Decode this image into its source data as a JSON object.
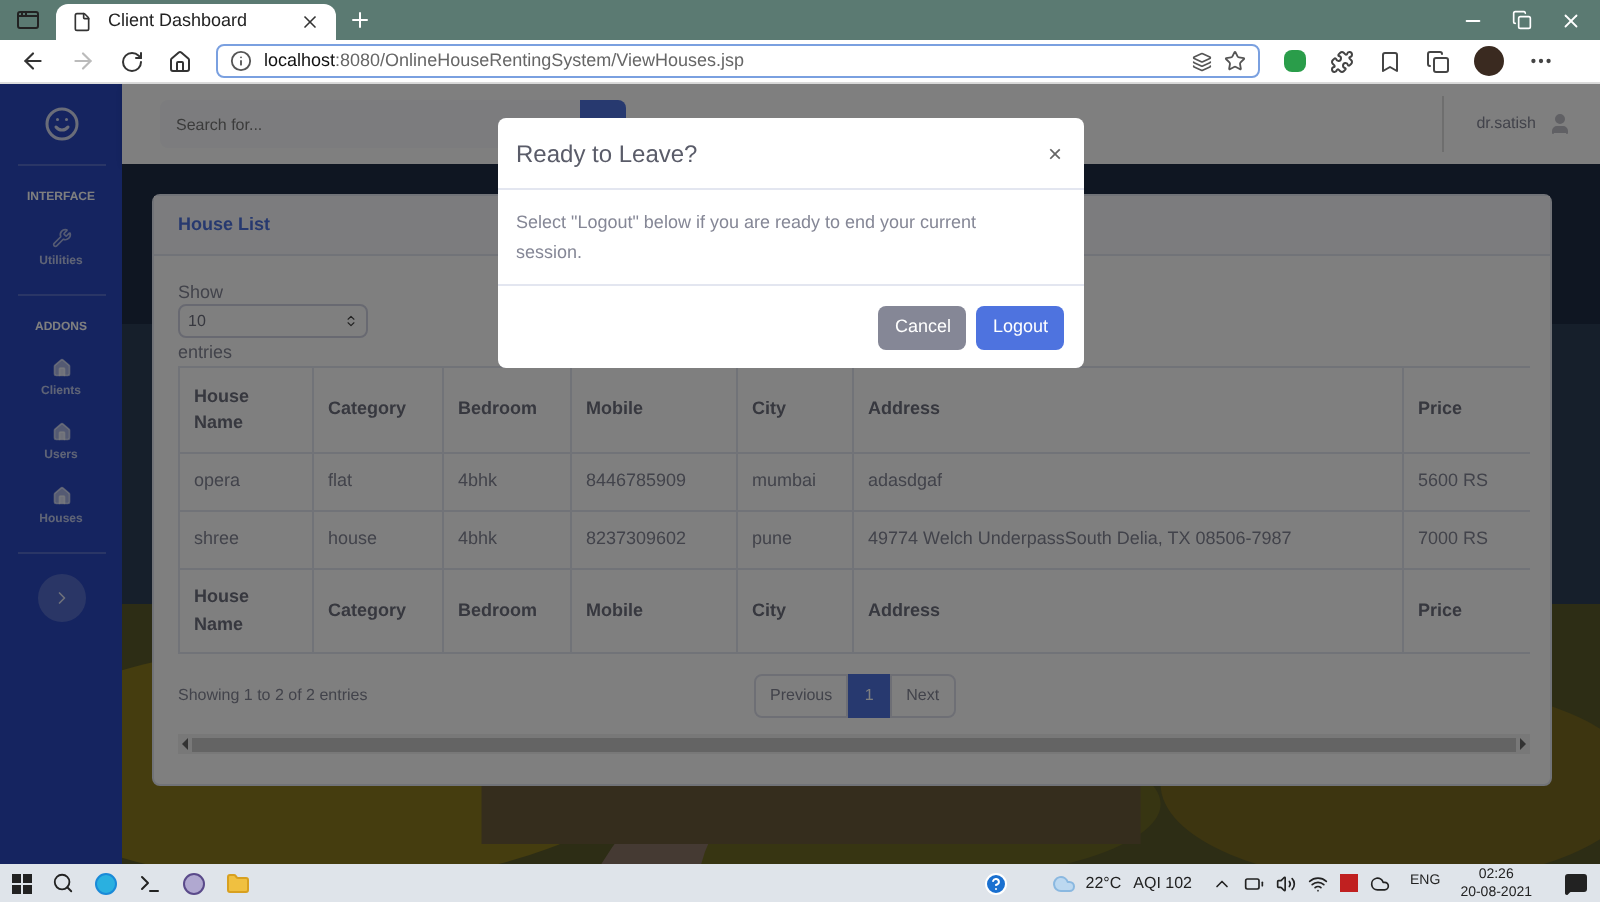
{
  "browser": {
    "tabs": [
      {
        "title": "Client Dashboard",
        "selected": true
      }
    ],
    "url_host": "localhost",
    "url_path": ":8080/OnlineHouseRentingSystem/ViewHouses.jsp"
  },
  "sidebar": {
    "sections": [
      {
        "heading": "INTERFACE",
        "items": [
          {
            "label": "Utilities",
            "kind": "wrench"
          }
        ]
      },
      {
        "heading": "ADDONS",
        "items": [
          {
            "label": "Clients",
            "kind": "home"
          },
          {
            "label": "Users",
            "kind": "home"
          },
          {
            "label": "Houses",
            "kind": "home"
          }
        ]
      }
    ]
  },
  "topbar": {
    "search": {
      "placeholder": "Search for..."
    },
    "user": "dr.satish"
  },
  "card": {
    "title": "House List",
    "show_label": "Show",
    "page_size": "10",
    "entries_label": "entries",
    "columns": [
      "House Name",
      "Category",
      "Bedroom",
      "Mobile",
      "City",
      "Address",
      "Price"
    ],
    "rows": [
      [
        "opera",
        "flat",
        "4bhk",
        "8446785909",
        "mumbai",
        "adasdgaf",
        "5600 RS"
      ],
      [
        "shree",
        "house",
        "4bhk",
        "8237309602",
        "pune",
        "49774 Welch UnderpassSouth Delia, TX 08506-7987",
        "7000 RS"
      ]
    ],
    "footer_columns": [
      "House Name",
      "Category",
      "Bedroom",
      "Mobile",
      "City",
      "Address",
      "Price"
    ],
    "info": "Showing 1 to 2 of 2 entries",
    "previous": "Previous",
    "pages": [
      {
        "label": "1",
        "selected": true
      }
    ],
    "next": "Next"
  },
  "modal": {
    "title": "Ready to Leave?",
    "close": "×",
    "body": "Select \"Logout\" below if you are ready to end your current session.",
    "buttons": [
      {
        "label": "Cancel",
        "kind": "secondary"
      },
      {
        "label": "Logout",
        "kind": "primary"
      }
    ]
  },
  "taskbar": {
    "temperature": "22°C",
    "aqi": "AQI 102",
    "language": "ENG",
    "time": "02:26",
    "date": "20-08-2021"
  }
}
